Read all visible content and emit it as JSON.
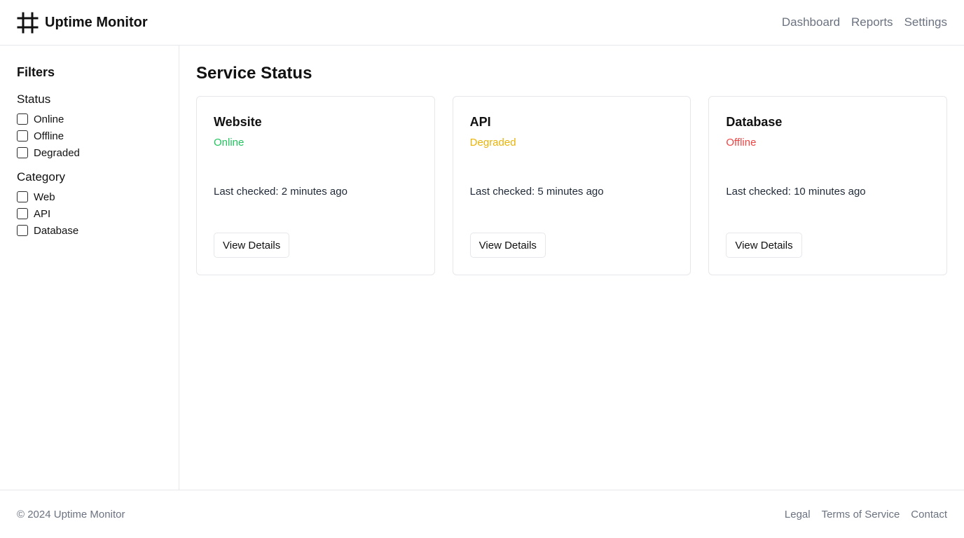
{
  "app": {
    "title": "Uptime Monitor",
    "logo_icon": "hash-grid-icon"
  },
  "nav": {
    "items": [
      "Dashboard",
      "Reports",
      "Settings"
    ]
  },
  "filters": {
    "title": "Filters",
    "status": {
      "title": "Status",
      "options": [
        "Online",
        "Offline",
        "Degraded"
      ]
    },
    "category": {
      "title": "Category",
      "options": [
        "Web",
        "API",
        "Database"
      ]
    }
  },
  "main": {
    "title": "Service Status",
    "services": [
      {
        "name": "Website",
        "status": "Online",
        "status_color": "#22c55e",
        "checked": "Last checked: 2 minutes ago",
        "button": "View Details"
      },
      {
        "name": "API",
        "status": "Degraded",
        "status_color": "#eab308",
        "checked": "Last checked: 5 minutes ago",
        "button": "View Details"
      },
      {
        "name": "Database",
        "status": "Offline",
        "status_color": "#ef4444",
        "checked": "Last checked: 10 minutes ago",
        "button": "View Details"
      }
    ]
  },
  "footer": {
    "copyright": "© 2024 Uptime Monitor",
    "links": [
      "Legal",
      "Terms of Service",
      "Contact"
    ]
  },
  "colors": {
    "muted_text": "#6b7280",
    "border": "#e5e7eb",
    "online": "#22c55e",
    "degraded": "#eab308",
    "offline": "#ef4444"
  }
}
